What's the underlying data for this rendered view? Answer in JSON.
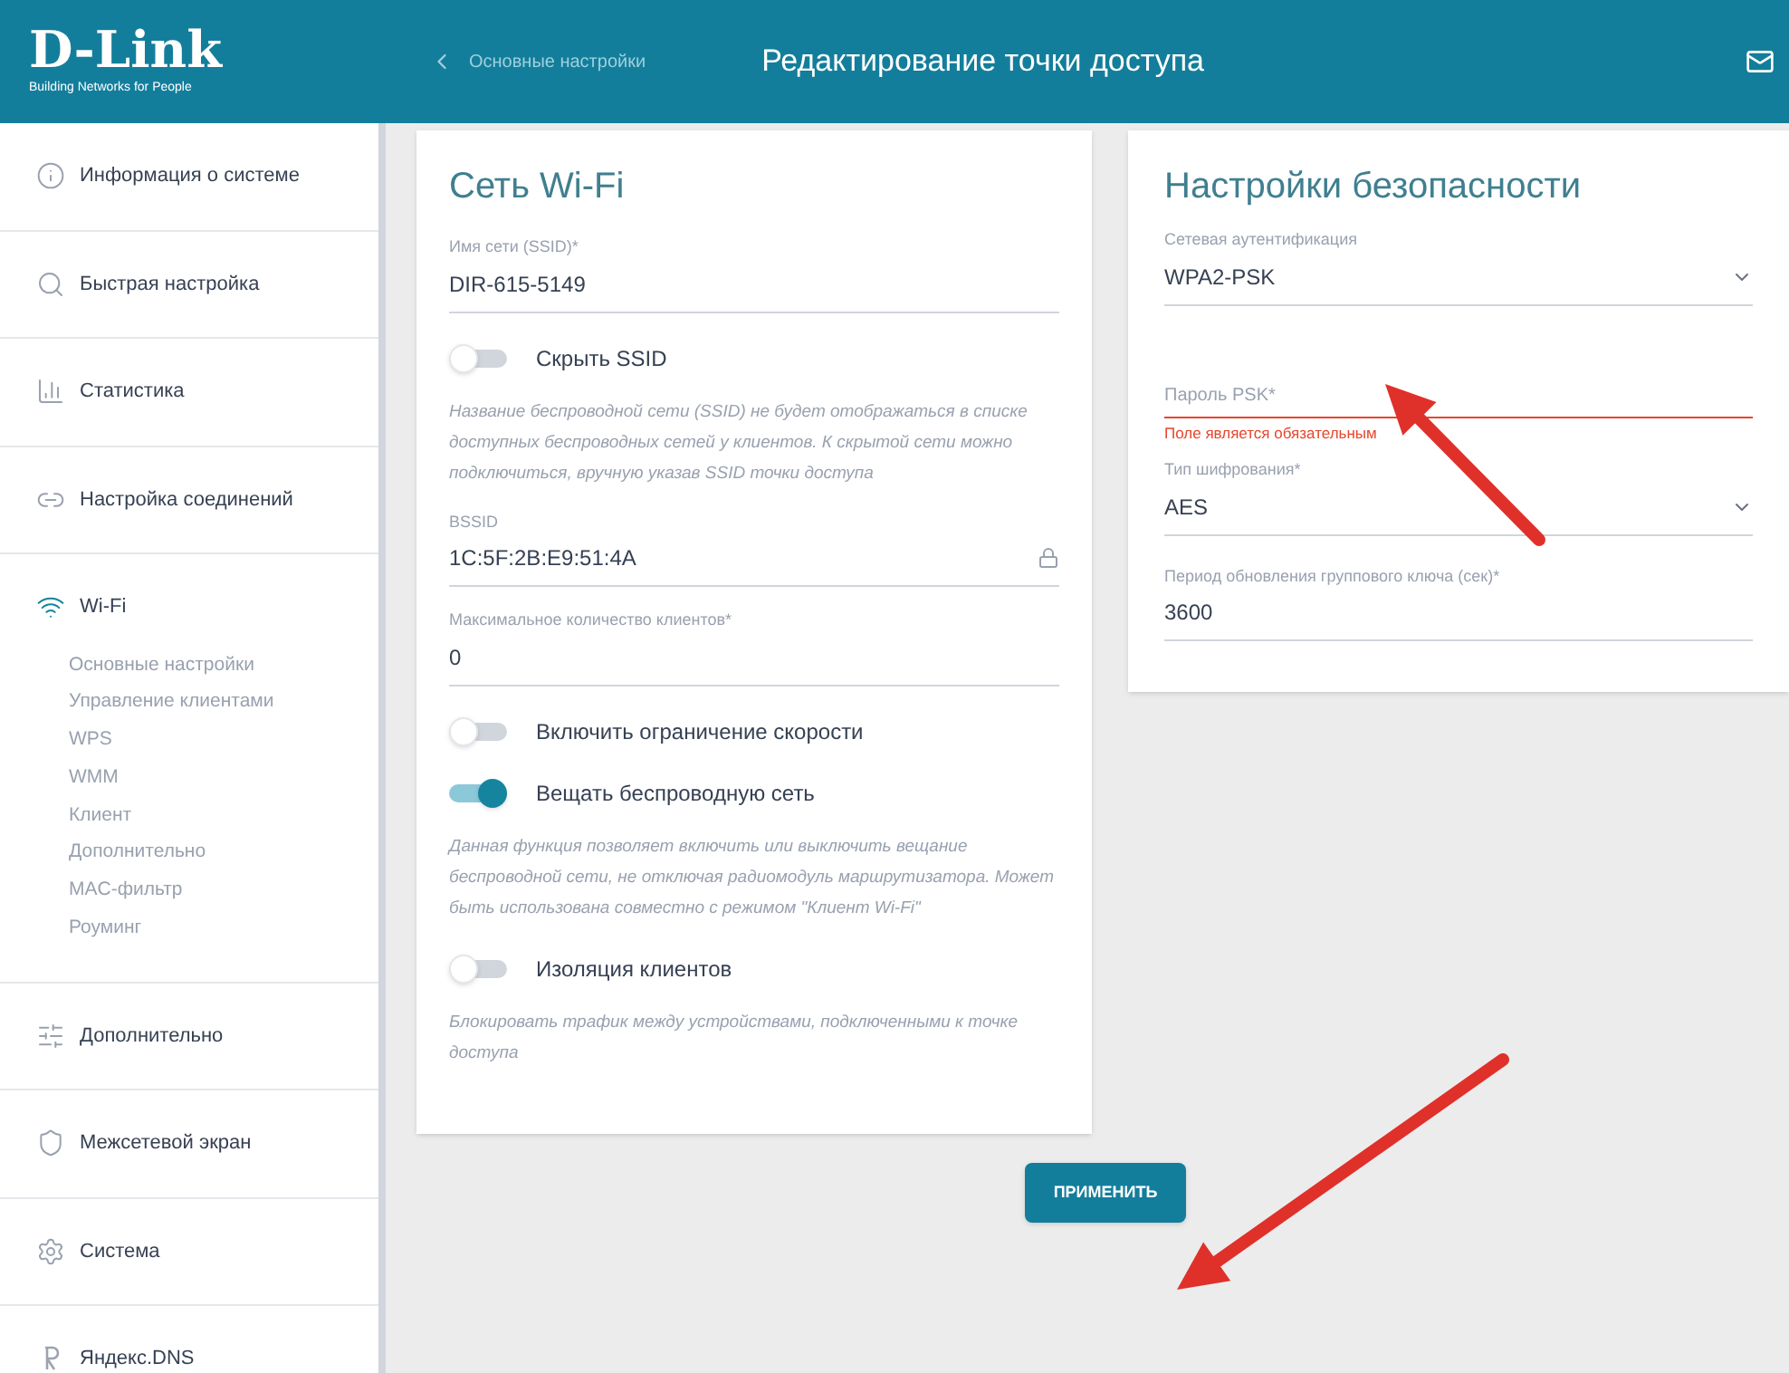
{
  "header": {
    "logo": "D-Link",
    "tagline": "Building Networks for People",
    "back": "Основные настройки",
    "title": "Редактирование точки доступа"
  },
  "sidebar": {
    "items": [
      {
        "label": "Информация о системе"
      },
      {
        "label": "Быстрая настройка"
      },
      {
        "label": "Статистика"
      },
      {
        "label": "Настройка соединений"
      },
      {
        "label": "Wi-Fi",
        "children": [
          {
            "label": "Основные настройки"
          },
          {
            "label": "Управление клиентами"
          },
          {
            "label": "WPS"
          },
          {
            "label": "WMM"
          },
          {
            "label": "Клиент"
          },
          {
            "label": "Дополнительно"
          },
          {
            "label": "MAC-фильтр"
          },
          {
            "label": "Роуминг"
          }
        ]
      },
      {
        "label": "Дополнительно"
      },
      {
        "label": "Межсетевой экран"
      },
      {
        "label": "Система"
      },
      {
        "label": "Яндекс.DNS"
      }
    ]
  },
  "wifi_card": {
    "title": "Сеть Wi-Fi",
    "items": [
      {
        "kind": "field",
        "label": "Имя сети (SSID)*",
        "value": "DIR-615-5149",
        "locked": false
      },
      {
        "kind": "switch",
        "label": "Скрыть SSID",
        "on": false
      },
      {
        "kind": "hint",
        "text": "Название беспроводной сети (SSID) не будет отображаться в списке доступных беспроводных сетей у клиентов. К скрытой сети можно подключиться, вручную указав SSID точки доступа"
      },
      {
        "kind": "field",
        "label": "BSSID",
        "value": "1C:5F:2B:E9:51:4A",
        "locked": true
      },
      {
        "kind": "field",
        "label": "Максимальное количество клиентов*",
        "value": "0",
        "locked": false
      },
      {
        "kind": "switch",
        "label": "Включить ограничение скорости",
        "on": false
      },
      {
        "kind": "switch",
        "label": "Вещать беспроводную сеть",
        "on": true
      },
      {
        "kind": "hint",
        "text": "Данная функция позволяет включить или выключить вещание беспроводной сети, не отключая радиомодуль маршрутизатора. Может быть использована совместно с режимом \"Клиент Wi-Fi\""
      },
      {
        "kind": "switch",
        "label": "Изоляция клиентов",
        "on": false
      },
      {
        "kind": "hint",
        "text": "Блокировать трафик между устройствами, подключенными к точке доступа"
      }
    ]
  },
  "security_card": {
    "title": "Настройки безопасности",
    "items": [
      {
        "kind": "select",
        "label": "Сетевая аутентификация",
        "value": "WPA2-PSK"
      },
      {
        "kind": "password",
        "placeholder": "Пароль PSK*",
        "error": "Поле является обязательным"
      },
      {
        "kind": "select",
        "label": "Тип шифрования*",
        "value": "AES"
      },
      {
        "kind": "field",
        "label": "Период обновления группового ключа (сек)*",
        "value": "3600"
      }
    ]
  },
  "apply_button": "ПРИМЕНИТЬ"
}
